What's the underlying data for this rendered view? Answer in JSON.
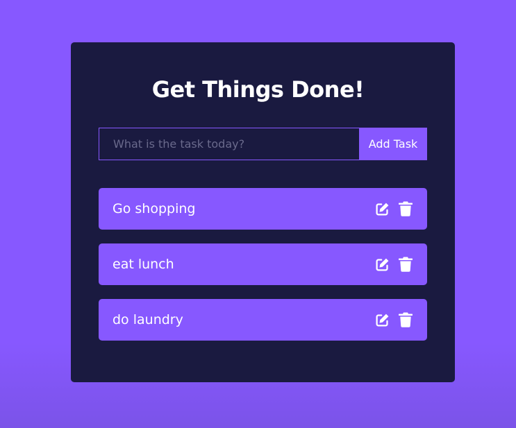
{
  "header": {
    "title": "Get Things Done!"
  },
  "form": {
    "placeholder": "What is the task today?",
    "value": "",
    "add_label": "Add Task"
  },
  "todos": [
    {
      "text": "Go shopping",
      "edit_icon": "edit-icon",
      "delete_icon": "trash-icon"
    },
    {
      "text": "eat lunch",
      "edit_icon": "edit-icon",
      "delete_icon": "trash-icon"
    },
    {
      "text": "do laundry",
      "edit_icon": "edit-icon",
      "delete_icon": "trash-icon"
    }
  ],
  "colors": {
    "page_background": "#8758ff",
    "card_background": "#1a1a40",
    "accent": "#8758ff",
    "text": "#ffffff",
    "placeholder": "#6a6a8c"
  }
}
